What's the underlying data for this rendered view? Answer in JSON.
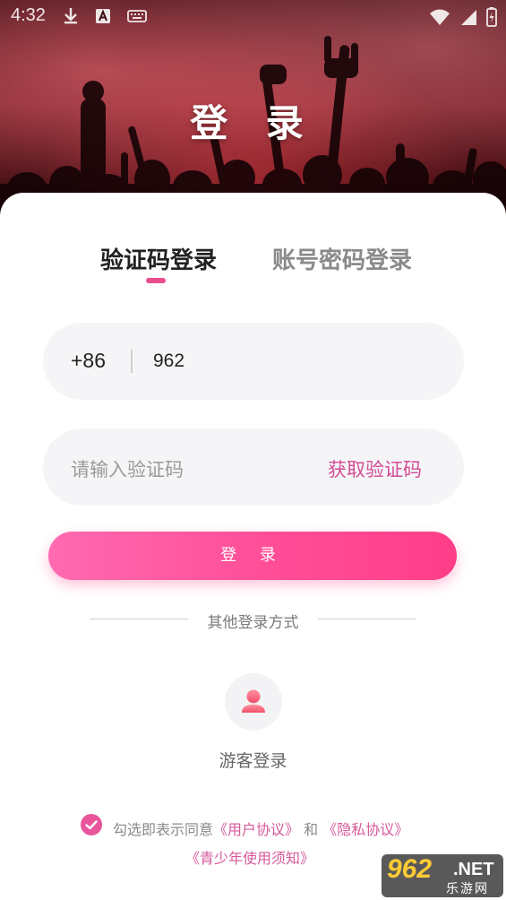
{
  "status_bar": {
    "time": "4:32",
    "icons_left": [
      "download-icon",
      "keyboard-a-icon",
      "keyboard-icon"
    ],
    "icons_right": [
      "wifi-icon",
      "signal-icon",
      "battery-charging-icon"
    ]
  },
  "header": {
    "title": "登 录"
  },
  "tabs": [
    {
      "label": "验证码登录",
      "active": true
    },
    {
      "label": "账号密码登录",
      "active": false
    }
  ],
  "phone_field": {
    "country_code": "+86",
    "value": "962"
  },
  "code_field": {
    "placeholder": "请输入验证码",
    "action_label": "获取验证码"
  },
  "login_button": {
    "label": "登 录"
  },
  "other_login": {
    "divider_text": "其他登录方式",
    "guest_label": "游客登录",
    "guest_icon": "user-icon"
  },
  "agreement": {
    "checked": true,
    "prefix": "勾选即表示同意",
    "user_agreement": "《用户协议》",
    "and": " 和 ",
    "privacy_policy": "《隐私协议》",
    "youth_notice": "《青少年使用须知》"
  },
  "watermark": {
    "main": "962",
    "suffix": ".NET",
    "sub": "乐游网"
  },
  "colors": {
    "accent": "#e8559a",
    "button_start": "#ff6ab0",
    "button_end": "#ff3d88",
    "field_bg": "#f5f5f7"
  }
}
